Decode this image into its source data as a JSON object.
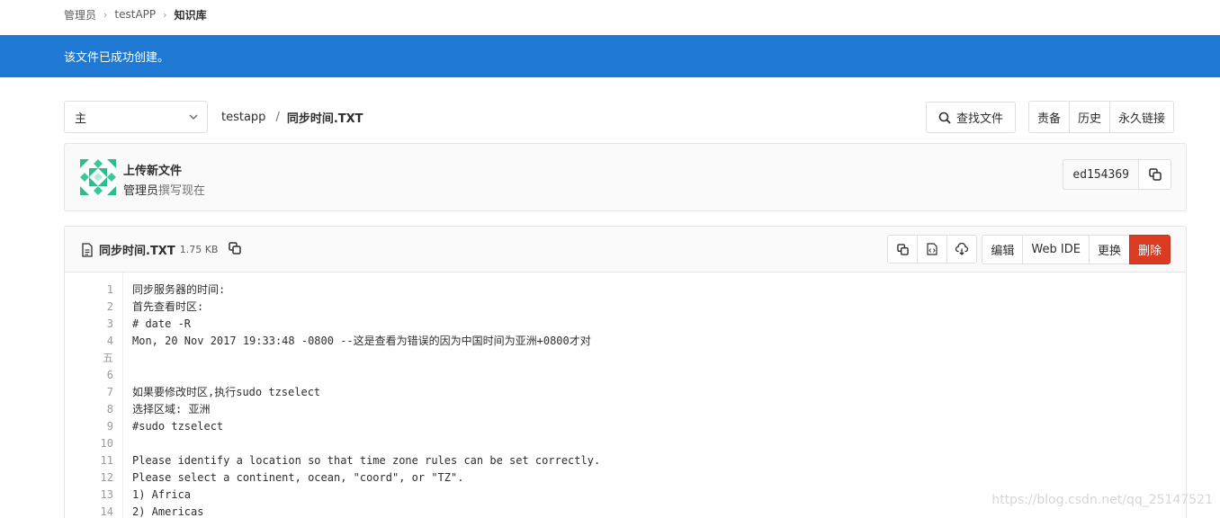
{
  "breadcrumb": {
    "items": [
      "管理员",
      "testAPP",
      "知识库"
    ]
  },
  "flash": {
    "message": "该文件已成功创建。"
  },
  "nav": {
    "branch": "主",
    "repo": "testapp",
    "separator": "/",
    "file": "同步时间.TXT",
    "find_label": "查找文件",
    "blame_label": "责备",
    "history_label": "历史",
    "permalink_label": "永久链接"
  },
  "commit": {
    "title": "上传新文件",
    "author": "管理员",
    "action": "撰写现在",
    "sha": "ed154369"
  },
  "file": {
    "name": "同步时间.TXT",
    "size": "1.75 KB",
    "edit_label": "编辑",
    "webide_label": "Web IDE",
    "replace_label": "更换",
    "delete_label": "删除"
  },
  "code": {
    "line_numbers": [
      "1",
      "2",
      "3",
      "4",
      "五",
      "6",
      "7",
      "8",
      "9",
      "10",
      "11",
      "12",
      "13",
      "14"
    ],
    "lines": [
      "同步服务器的时间:",
      "首先查看时区:",
      "# date -R",
      "Mon, 20 Nov 2017 19:33:48 -0800 --这是查看为错误的因为中国时间为亚洲+0800才对",
      "",
      "",
      "如果要修改时区,执行sudo tzselect",
      "选择区域: 亚洲",
      "#sudo tzselect",
      "",
      "Please identify a location so that time zone rules can be set correctly.",
      "Please select a continent, ocean, \"coord\", or \"TZ\".",
      "1) Africa",
      "2) Americas"
    ]
  },
  "watermark": "https://blog.csdn.net/qq_25147521",
  "colors": {
    "flash_bg": "#1f78d1",
    "danger": "#db3b21"
  },
  "icons": [
    "chevron-right-icon",
    "chevron-down-icon",
    "search-icon",
    "copy-icon",
    "file-text-icon",
    "raw-file-icon",
    "download-icon",
    "identicon-avatar"
  ]
}
